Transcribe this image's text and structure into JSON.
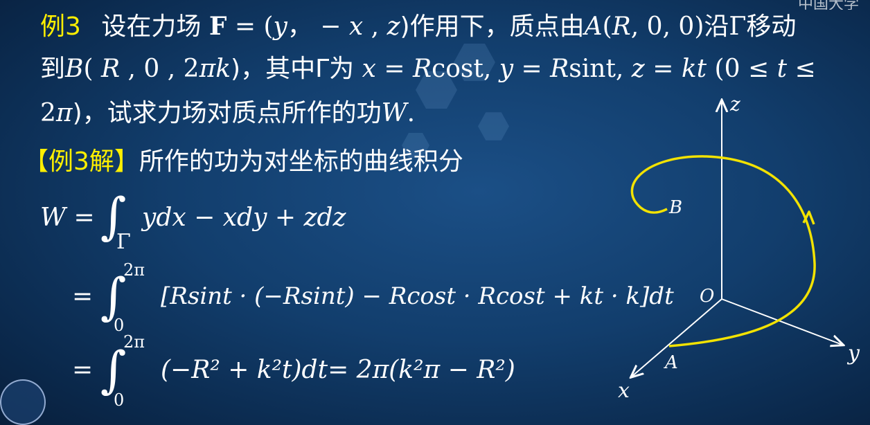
{
  "problem": {
    "label": "例3",
    "line1_a": "设在力场",
    "line1_b": "F",
    "line1_c": " = (",
    "line1_d": "y",
    "line1_e": "， − ",
    "line1_f": "x",
    "line1_g": " , ",
    "line1_h": "z",
    "line1_i": ")作用下，质点由",
    "line1_j": "A",
    "line1_k": "(",
    "line1_l": "R",
    "line1_m": ", 0, 0)沿Γ移动",
    "line2_a": "到",
    "line2_b": "B",
    "line2_c": "( ",
    "line2_d": "R",
    "line2_e": " , 0 , 2",
    "line2_f": "πk",
    "line2_g": ")，其中Γ为 ",
    "line2_h": "x",
    "line2_i": " = ",
    "line2_j": "R",
    "line2_k": "cost, ",
    "line2_l": "y",
    "line2_m": " = ",
    "line2_n": "R",
    "line2_o": "sint, ",
    "line2_p": "z",
    "line2_q": " = ",
    "line2_r": "kt",
    "line2_s": " (0 ≤ ",
    "line2_t": "t",
    "line2_u": " ≤",
    "line3_a": "2",
    "line3_b": "π",
    "line3_c": ")，试求力场对质点所作的功",
    "line3_d": "W",
    "line3_e": "."
  },
  "solution": {
    "label": "【例3解】",
    "intro": "所作的功为对坐标的曲线积分",
    "eq1_lhs": "W",
    "eq1_eq": " = ",
    "eq1_sub": "Γ",
    "eq1_body": "ydx − xdy + zdz",
    "eq2_eq": "=",
    "eq2_sup": "2π",
    "eq2_sub": "0",
    "eq2_body": "[Rsint · (−Rsint) − Rcost · Rcost + kt · k]dt",
    "eq3_eq": "=",
    "eq3_sup": "2π",
    "eq3_sub": "0",
    "eq3_body": "(−R² + k²t)dt= 2π(k²π − R²)"
  },
  "diagram": {
    "axis_z": "z",
    "axis_y": "y",
    "axis_x": "x",
    "origin": "O",
    "point_a": "A",
    "point_b": "B",
    "curve_color": "#f2e200",
    "axis_color": "#ffffff"
  },
  "corner_text": "中国大学"
}
